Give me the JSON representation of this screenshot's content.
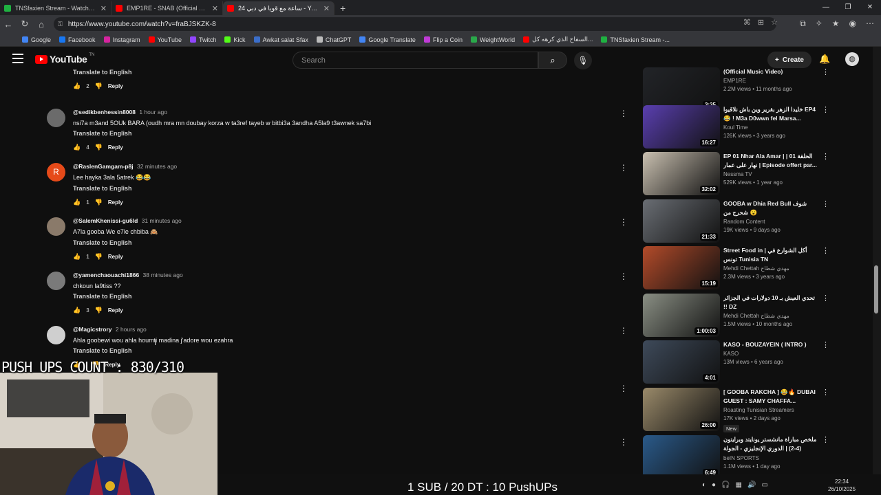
{
  "browser": {
    "tabs": [
      {
        "title": "TNSfaxien Stream - Watch Live o",
        "color": "#1fb141",
        "active": false
      },
      {
        "title": "EMP1RE - SNAB (Official Music V",
        "color": "#ff0000",
        "active": false
      },
      {
        "title": "24 ساعة مع قويا في دبي - YouTube",
        "color": "#ff0000",
        "active": true
      }
    ],
    "new_tab": "+",
    "url": "https://www.youtube.com/watch?v=fraBJSKZK-8",
    "bookmarks": [
      {
        "label": "Google",
        "color": "#4285f4"
      },
      {
        "label": "Facebook",
        "color": "#1877f2"
      },
      {
        "label": "Instagram",
        "color": "#d6249f"
      },
      {
        "label": "YouTube",
        "color": "#ff0000"
      },
      {
        "label": "Twitch",
        "color": "#9146ff"
      },
      {
        "label": "Kick",
        "color": "#53fc18"
      },
      {
        "label": "Awkat salat Sfax",
        "color": "#3b6ec9"
      },
      {
        "label": "ChatGPT",
        "color": "#bbbbbb"
      },
      {
        "label": "Google Translate",
        "color": "#4285f4"
      },
      {
        "label": "Flip a Coin",
        "color": "#c03bd6"
      },
      {
        "label": "WeightWorld",
        "color": "#2aa84a"
      },
      {
        "label": "السفاح الذي كرهه كل...",
        "color": "#ff0000"
      },
      {
        "label": "TNSfaxien Stream -...",
        "color": "#1fb141"
      }
    ]
  },
  "youtube": {
    "logo": "YouTube",
    "logo_suffix": "TN",
    "search_placeholder": "Search",
    "create_label": "Create"
  },
  "comments": [
    {
      "author": "",
      "time": "",
      "text": "",
      "translate": "Translate to English",
      "likes": "2",
      "reply": "Reply",
      "avatar_letter": "",
      "avatar_color": "#444"
    },
    {
      "author": "@sedikbenhessin8008",
      "time": "1 hour ago",
      "text": "nsi7a m3and 5OUk BARA (oudh mra mn doubay korza w ta3ref tayeb w bitbi3a 3andha A5la9 t3awnek sa7bi",
      "translate": "Translate to English",
      "likes": "4",
      "reply": "Reply",
      "avatar_letter": "",
      "avatar_color": "#6b6b6b"
    },
    {
      "author": "@RaslenGamgam-p8j",
      "time": "32 minutes ago",
      "text": "Lee hayka 3ala 5atrek 😂😂",
      "translate": "Translate to English",
      "likes": "1",
      "reply": "Reply",
      "avatar_letter": "R",
      "avatar_color": "#e64a19"
    },
    {
      "author": "@SalemKhenissi-gu6ld",
      "time": "31 minutes ago",
      "text": "A7la gooba We e7le chbiba 🙈",
      "translate": "Translate to English",
      "likes": "1",
      "reply": "Reply",
      "avatar_letter": "",
      "avatar_color": "#8a7a6a"
    },
    {
      "author": "@yamenchaouachi1866",
      "time": "38 minutes ago",
      "text": "chkoun la9tiss ??",
      "translate": "Translate to English",
      "likes": "3",
      "reply": "Reply",
      "avatar_letter": "",
      "avatar_color": "#7a7a7a"
    },
    {
      "author": "@Magicstrory",
      "time": "2 hours ago",
      "text": "Ahla goobewi wou ahla houmti madina j'adore wou ezahra",
      "translate": "Translate to English",
      "likes": "",
      "reply": "Reply",
      "avatar_letter": "",
      "avatar_color": "#cfcfcf"
    }
  ],
  "videos": [
    {
      "title": "(Official Music Video)",
      "channel": "EMP1RE",
      "meta": "2.2M views • 11 months ago",
      "duration": "3:35",
      "thumb": "#222428",
      "badge": ""
    },
    {
      "title": "خليدا الزهر بقرير وين باش نلاقيوا EP4 😂 ! M3a D0wwn  fel Marsa...",
      "channel": "Koul Time",
      "meta": "126K views • 3 years ago",
      "duration": "16:27",
      "thumb": "#5a3fb0",
      "badge": ""
    },
    {
      "title": "EP 01 Nhar Ala Amar | الحلقة 01 | نهار على عمار | Episode offert par...",
      "channel": "Nessma TV",
      "meta": "529K views • 1 year ago",
      "duration": "32:02",
      "thumb": "#c9c0b0",
      "badge": ""
    },
    {
      "title": "GOOBA w Dhia Red Bull شوف شحرج من 😮",
      "channel": "Random Content",
      "meta": "19K views • 9 days ago",
      "duration": "21:33",
      "thumb": "#6a6e74",
      "badge": ""
    },
    {
      "title": "Street Food in | أكل الشوارع في تونس Tunisia TN",
      "channel": "Mehdi Chettah مهدي شطاح",
      "meta": "2.3M views • 3 years ago",
      "duration": "15:19",
      "thumb": "#b34b2a",
      "badge": ""
    },
    {
      "title": "تحدي العيش بـ 10 دولارات في الجزائر !! DZ",
      "channel": "Mehdi Chettah مهدي شطاح",
      "meta": "1.5M views • 10 months ago",
      "duration": "1:00:03",
      "thumb": "#8a8f84",
      "badge": ""
    },
    {
      "title": "KASO - BOUZAYEIN ( INTRO )",
      "channel": "KASO",
      "meta": "13M views • 6 years ago",
      "duration": "4:01",
      "thumb": "#3e4a5a",
      "badge": ""
    },
    {
      "title": "[ GOOBA RAKCHA ] 😂🔥 DUBAI GUEST : SAMY CHAFFA...",
      "channel": "Roasting Tunisian Streamers",
      "meta": "17K views • 2 days ago",
      "duration": "26:00",
      "thumb": "#9a8a6a",
      "badge": "New"
    },
    {
      "title": "ملخص مباراة مانشستر يونايتد وبرايتون (4-2) | الدوري الإنجليزي - الجولة التاسعة",
      "channel": "beIN SPORTS",
      "meta": "1.1M views • 1 day ago",
      "duration": "6:49",
      "thumb": "#2a5a8a",
      "badge": ""
    }
  ],
  "overlay": {
    "pushups": "PUSH UPS COUNT : 830/310",
    "sub_text": "1 SUB / 20 DT : 10 PushUPs"
  },
  "taskbar": {
    "time": "22:34",
    "date": "26/10/2025"
  }
}
